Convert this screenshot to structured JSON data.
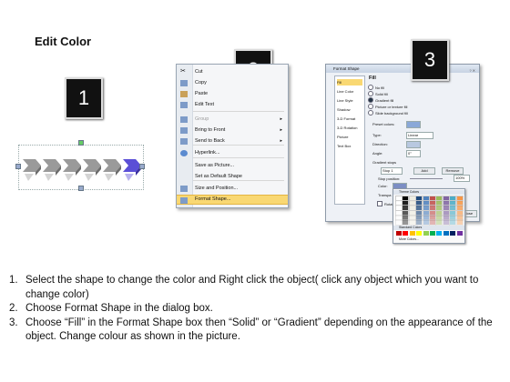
{
  "title": "Edit Color",
  "badges": [
    "1",
    "2",
    "3"
  ],
  "context_menu": {
    "items": [
      {
        "label": "Cut",
        "disabled": false,
        "arrow": false,
        "highlight": false,
        "icon": "scissors-icon"
      },
      {
        "label": "Copy",
        "disabled": false,
        "arrow": false,
        "highlight": false,
        "icon": "copy-icon"
      },
      {
        "label": "Paste",
        "disabled": false,
        "arrow": false,
        "highlight": false,
        "icon": "paste-icon"
      },
      {
        "label": "Edit Text",
        "disabled": false,
        "arrow": false,
        "highlight": false,
        "icon": "edit-text-icon"
      },
      {
        "label": "Group",
        "disabled": true,
        "arrow": true,
        "highlight": false,
        "icon": "group-icon"
      },
      {
        "label": "Bring to Front",
        "disabled": false,
        "arrow": true,
        "highlight": false,
        "icon": "bring-to-front-icon"
      },
      {
        "label": "Send to Back",
        "disabled": false,
        "arrow": true,
        "highlight": false,
        "icon": "send-to-back-icon"
      },
      {
        "label": "Hyperlink...",
        "disabled": false,
        "arrow": false,
        "highlight": false,
        "icon": "hyperlink-icon"
      },
      {
        "label": "Save as Picture...",
        "disabled": false,
        "arrow": false,
        "highlight": false,
        "icon": ""
      },
      {
        "label": "Set as Default Shape",
        "disabled": false,
        "arrow": false,
        "highlight": false,
        "icon": ""
      },
      {
        "label": "Size and Position...",
        "disabled": false,
        "arrow": false,
        "highlight": false,
        "icon": "size-position-icon"
      },
      {
        "label": "Format Shape...",
        "disabled": false,
        "arrow": false,
        "highlight": true,
        "icon": "format-shape-icon"
      }
    ]
  },
  "dialog": {
    "title": "Format Shape",
    "categories": [
      "Fill",
      "Line Color",
      "Line Style",
      "Shadow",
      "3-D Format",
      "3-D Rotation",
      "Picture",
      "Text Box"
    ],
    "selected_category": "Fill",
    "fill_heading": "Fill",
    "options": [
      "No fill",
      "Solid fill",
      "Gradient fill",
      "Picture or texture fill",
      "Slide background fill"
    ],
    "selected_option": "Gradient fill",
    "preset_colors_label": "Preset colors:",
    "type_label": "Type:",
    "type_value": "Linear",
    "direction_label": "Direction:",
    "angle_label": "Angle:",
    "angle_value": "0°",
    "gradient_stops_label": "Gradient stops",
    "stop_value": "Stop 1",
    "add_label": "Add",
    "remove_label": "Remove",
    "stop_position_label": "Stop position:",
    "stop_position_value": "100%",
    "color_label": "Color:",
    "transparency_label": "Transpa",
    "rotate_label": "Rotate",
    "close_label": "Close"
  },
  "color_palette": {
    "theme_header": "Theme Colors",
    "standard_header": "Standard Colors",
    "more_label": "More Colors...",
    "theme_colors": [
      "#ffffff",
      "#000000",
      "#eeece1",
      "#1f497d",
      "#4f81bd",
      "#c0504d",
      "#9bbb59",
      "#8064a2",
      "#4bacc6",
      "#f79646"
    ],
    "standard_colors": [
      "#c00000",
      "#ff0000",
      "#ffc000",
      "#ffff00",
      "#92d050",
      "#00b050",
      "#00b0f0",
      "#0070c0",
      "#002060",
      "#7030a0"
    ]
  },
  "arrow_colors": {
    "normal": "#9a9a9a",
    "selected": "#5b4fd6"
  },
  "instructions": [
    {
      "num": "1.",
      "text": "Select the shape to change the color and Right click the object( click any object which you want to change color)"
    },
    {
      "num": "2.",
      "text": "Choose Format Shape in the dialog box."
    },
    {
      "num": "3.",
      "text": "Choose “Fill” in the Format Shape box then “Solid” or “Gradient” depending on the appearance of the object. Change colour as shown in the picture."
    }
  ]
}
